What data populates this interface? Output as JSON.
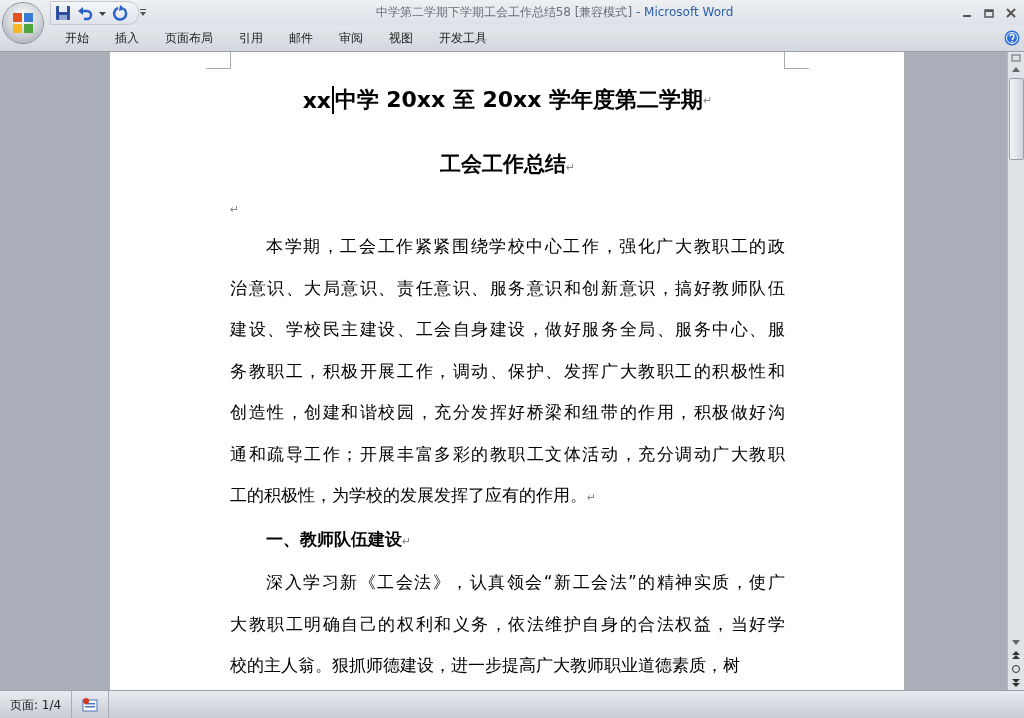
{
  "window": {
    "title": "中学第二学期下学期工会工作总结58 [兼容模式]",
    "app_name": "- Microsoft Word"
  },
  "ribbon_tabs": [
    {
      "label": "开始"
    },
    {
      "label": "插入"
    },
    {
      "label": "页面布局"
    },
    {
      "label": "引用"
    },
    {
      "label": "邮件"
    },
    {
      "label": "审阅"
    },
    {
      "label": "视图"
    },
    {
      "label": "开发工具"
    }
  ],
  "document": {
    "title_before_cursor": "xx",
    "title_after_cursor": "中学 20xx 至 20xx 学年度第二学期",
    "subtitle": "工会工作总结",
    "paragraph_mark": "↵",
    "paragraphs": [
      {
        "kind": "empty",
        "end_mark": "↵"
      },
      {
        "kind": "body",
        "lines": [
          "本学期，工会工作紧紧围绕学校中心工作，强化广大教职工的政",
          "治意识、大局意识、责任意识、服务意识和创新意识，搞好教师队伍",
          "建设、学校民主建设、工会自身建设，做好服务全局、服务中心、服",
          "务教职工，积极开展工作，调动、保护、发挥广大教职工的积极性和",
          "创造性，创建和谐校园，充分发挥好桥梁和纽带的作用，积极做好沟",
          "通和疏导工作；开展丰富多彩的教职工文体活动，充分调动广大教职",
          "工的积极性，为学校的发展发挥了应有的作用。"
        ],
        "end_mark": "↵"
      },
      {
        "kind": "heading",
        "lines": [
          "一、教师队伍建设"
        ],
        "end_mark": "↵"
      },
      {
        "kind": "body",
        "lines": [
          "深入学习新《工会法》，认真领会“新工会法”的精神实质，使广",
          "大教职工明确自己的权利和义务，依法维护自身的合法权益，当好学",
          "校的主人翁。狠抓师德建设，进一步提高广大教师职业道德素质，树"
        ]
      }
    ]
  },
  "status_bar": {
    "page": "页面: 1/4"
  }
}
